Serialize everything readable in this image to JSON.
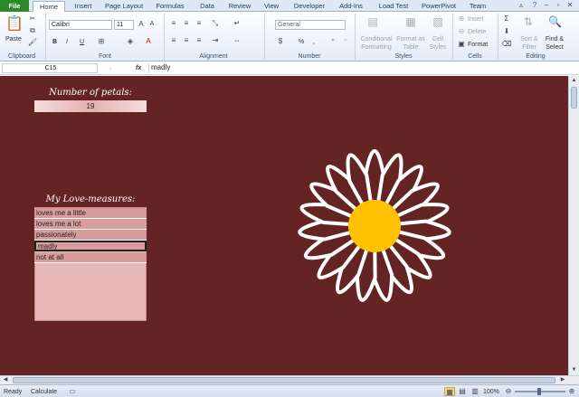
{
  "tabs": [
    "File",
    "Home",
    "Insert",
    "Page Layout",
    "Formulas",
    "Data",
    "Review",
    "View",
    "Developer",
    "Add-Ins",
    "Load Test",
    "PowerPivot",
    "Team"
  ],
  "ribbon": {
    "clipboard": {
      "label": "Clipboard",
      "paste": "Paste"
    },
    "font": {
      "label": "Font",
      "name": "Calibri",
      "size": "11",
      "bold": "B",
      "italic": "I",
      "underline": "U"
    },
    "alignment": {
      "label": "Alignment"
    },
    "number": {
      "label": "Number",
      "format": "General",
      "percent": "%",
      "comma": ","
    },
    "styles": {
      "label": "Styles",
      "conditional": "Conditional Formatting",
      "format_table": "Format as Table",
      "cell_styles": "Cell Styles"
    },
    "cells": {
      "label": "Cells",
      "insert": "Insert",
      "delete": "Delete",
      "format": "Format"
    },
    "editing": {
      "label": "Editing",
      "sort": "Sort & Filter",
      "find": "Find & Select"
    }
  },
  "formula_bar": {
    "name_box": "C15",
    "fx": "fx",
    "value": "madly"
  },
  "sheet": {
    "petals_label": "Number of petals:",
    "petals_value": "19",
    "measures_label": "My Love-measures:",
    "measures": [
      "loves me a little",
      "loves me a lot",
      "passionately",
      "madly",
      "not at all"
    ],
    "selected_index": 3
  },
  "status": {
    "ready": "Ready",
    "calculate": "Calculate",
    "zoom": "100%"
  },
  "colors": {
    "sheet_bg": "#642424",
    "row_fill": "#d89c9c",
    "list_bg": "#e8b8b8",
    "petal": "#ffffff",
    "center": "#ffc000",
    "file_tab": "#2a8a2a"
  }
}
